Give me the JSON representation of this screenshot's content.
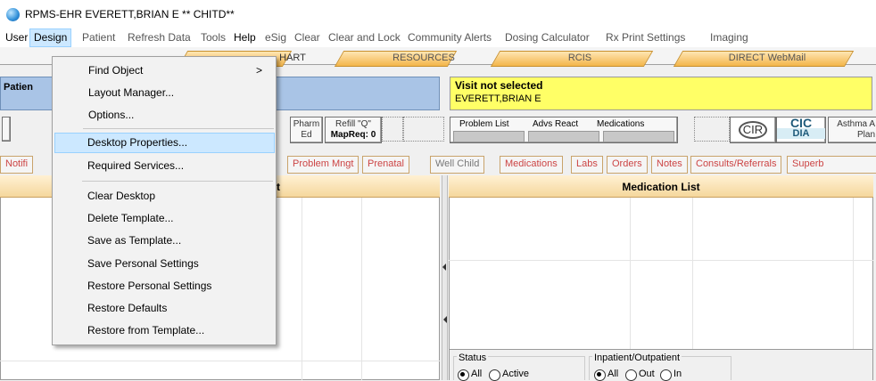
{
  "window": {
    "title": "RPMS-EHR EVERETT,BRIAN E  ** CHITD**"
  },
  "menubar": {
    "items": [
      "User",
      "Design",
      "Patient",
      "Refresh Data",
      "Tools",
      "Help",
      "eSig",
      "Clear",
      "Clear and Lock",
      "Community Alerts",
      "Dosing Calculator",
      "Rx Print Settings",
      "Imaging"
    ]
  },
  "top_tabs": [
    "HART",
    "RESOURCES",
    "RCIS",
    "DIRECT WebMail"
  ],
  "patient_panel": {
    "label": "Patien"
  },
  "visit_panel": {
    "status": "Visit not selected",
    "patient": "EVERETT,BRIAN E"
  },
  "toolbar": {
    "pharm_ed": "Pharm\nEd",
    "pharm": "Pharm",
    "ed": "Ed",
    "refill_top": "Refill \"Q\"",
    "refill_bottom": "MapReq: 0",
    "problem_list": "Problem List",
    "advs_react": "Advs React",
    "medications": "Medications",
    "cir": "CIR",
    "cic_top": "CIC",
    "cic_bottom": "DIA",
    "asthma_top": "Asthma A",
    "asthma_bottom": "Plan"
  },
  "section_tabs": [
    "Notifi",
    "Problem Mngt",
    "Prenatal",
    "Well Child",
    "Medications",
    "Labs",
    "Orders",
    "Notes",
    "Consults/Referrals",
    "Superb"
  ],
  "left_panel": {
    "header_fragment": "t"
  },
  "right_panel": {
    "title": "Medication List",
    "status_label": "Status",
    "status_all": "All",
    "status_active": "Active",
    "inout_label": "Inpatient/Outpatient",
    "inout_all": "All",
    "inout_out": "Out",
    "inout_in": "In"
  },
  "design_menu": {
    "find_object": "Find Object",
    "find_object_arrow": ">",
    "layout_manager": "Layout Manager...",
    "options": "Options...",
    "desktop_properties": "Desktop Properties...",
    "required_services": "Required Services...",
    "clear_desktop": "Clear Desktop",
    "delete_template": "Delete Template...",
    "save_as_template": "Save as Template...",
    "save_personal_settings": "Save Personal Settings",
    "restore_personal_settings": "Restore Personal Settings",
    "restore_defaults": "Restore Defaults",
    "restore_from_template": "Restore from Template..."
  },
  "colors": {
    "highlight": "#cce8ff",
    "visit_panel": "#ffff66",
    "patient_panel": "#a9c4e6",
    "tab_orange": "#f3b54a"
  }
}
